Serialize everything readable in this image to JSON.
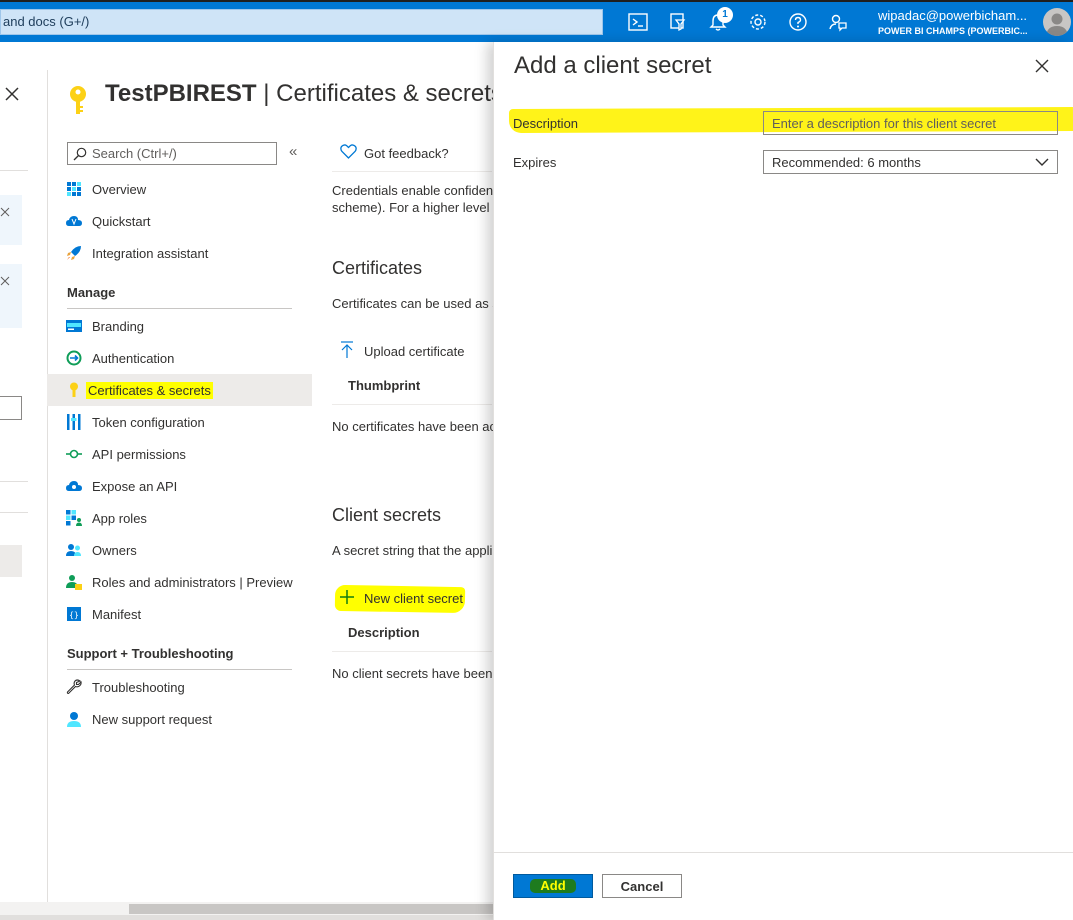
{
  "topbar": {
    "search_text": "and docs (G+/)",
    "notification_count": "1",
    "user_email": "wipadac@powerbicham...",
    "user_org": "POWER BI CHAMPS (POWERBIC..."
  },
  "blade": {
    "app_name": "TestPBIREST",
    "separator": " | ",
    "page_name": "Certificates & secrets",
    "search_placeholder": "Search (Ctrl+/)",
    "collapse_glyph": "«",
    "nav_top": [
      {
        "label": "Overview",
        "icon": "overview-grid-icon"
      },
      {
        "label": "Quickstart",
        "icon": "quickstart-cloud-icon"
      },
      {
        "label": "Integration assistant",
        "icon": "rocket-icon"
      }
    ],
    "manage_heading": "Manage",
    "nav_manage": [
      {
        "label": "Branding",
        "icon": "branding-icon"
      },
      {
        "label": "Authentication",
        "icon": "authentication-icon"
      },
      {
        "label": "Certificates & secrets",
        "icon": "key-icon"
      },
      {
        "label": "Token configuration",
        "icon": "token-bars-icon"
      },
      {
        "label": "API permissions",
        "icon": "api-permissions-icon"
      },
      {
        "label": "Expose an API",
        "icon": "cloud-api-icon"
      },
      {
        "label": "App roles",
        "icon": "app-roles-icon"
      },
      {
        "label": "Owners",
        "icon": "owners-icon"
      },
      {
        "label": "Roles and administrators | Preview",
        "icon": "roles-admins-icon"
      },
      {
        "label": "Manifest",
        "icon": "manifest-icon"
      }
    ],
    "support_heading": "Support + Troubleshooting",
    "nav_support": [
      {
        "label": "Troubleshooting",
        "icon": "wrench-icon"
      },
      {
        "label": "New support request",
        "icon": "support-person-icon"
      }
    ]
  },
  "content": {
    "feedback": "Got feedback?",
    "credentials_line1": "Credentials enable confident",
    "credentials_line2": "scheme). For a higher level c",
    "certificates_heading": "Certificates",
    "certificates_text": "Certificates can be used as s",
    "upload_certificate": "Upload certificate",
    "thumbprint_header": "Thumbprint",
    "no_certificates": "No certificates have been ac",
    "client_secrets_heading": "Client secrets",
    "client_secrets_text": "A secret string that the appli",
    "new_client_secret": "New client secret",
    "description_header": "Description",
    "no_client_secrets": "No client secrets have been"
  },
  "panel": {
    "title": "Add a client secret",
    "description_label": "Description",
    "description_placeholder": "Enter a description for this client secret",
    "expires_label": "Expires",
    "expires_value": "Recommended: 6 months",
    "add_label": "Add",
    "cancel_label": "Cancel"
  },
  "colors": {
    "accent": "#0078d4",
    "highlight": "#ffff00"
  }
}
